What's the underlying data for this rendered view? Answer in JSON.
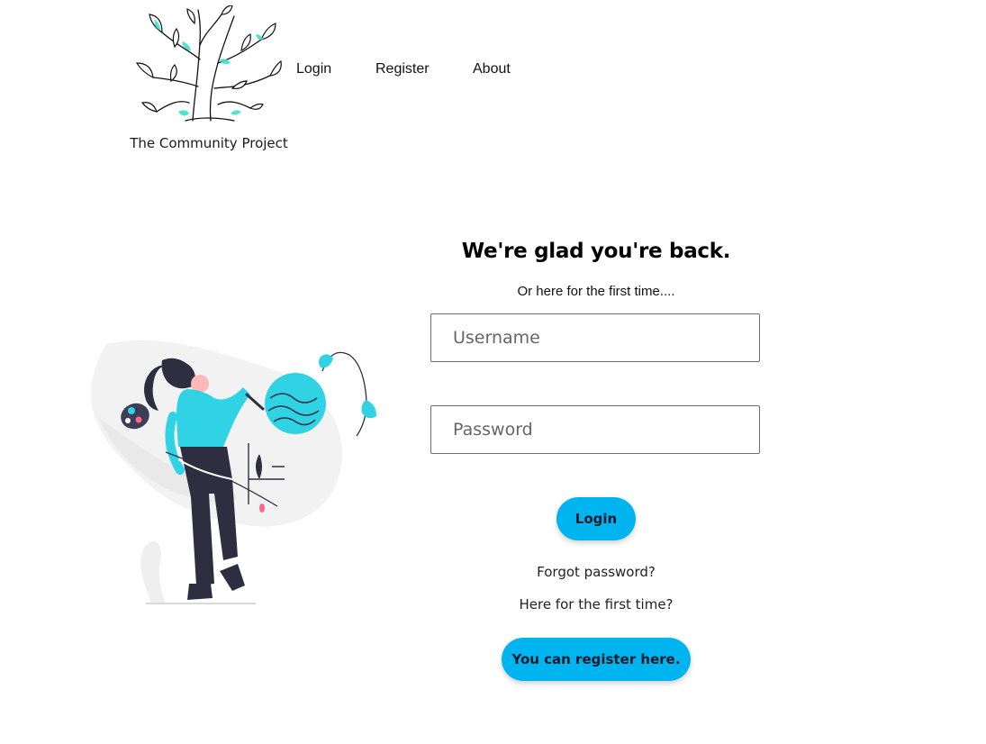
{
  "brand": {
    "name": "The Community Project",
    "logo_icon": "leafy-tree-logo"
  },
  "nav": {
    "items": [
      {
        "label": "Login"
      },
      {
        "label": "Register"
      },
      {
        "label": "About"
      }
    ]
  },
  "login_form": {
    "heading": "We're glad you're back.",
    "subheading": "Or here for the first time....",
    "username_placeholder": "Username",
    "password_placeholder": "Password",
    "login_button": "Login",
    "forgot_password": "Forgot password?",
    "first_time_text": "Here for the first time?",
    "register_button": "You can register here."
  },
  "illustration": {
    "icon": "woman-painting-illustration"
  },
  "colors": {
    "accent": "#00b4f0",
    "accent_light": "#2fd3e4",
    "dark": "#2f2e41",
    "pink": "#ff6584"
  }
}
